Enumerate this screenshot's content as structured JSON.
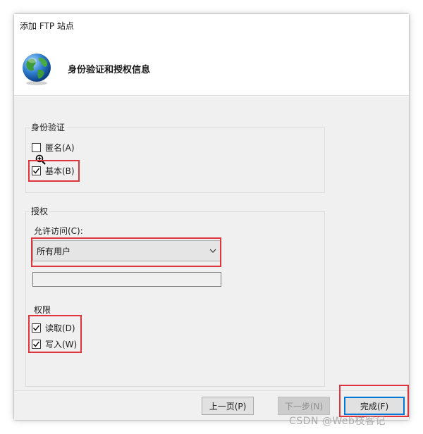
{
  "window": {
    "title": "添加 FTP 站点"
  },
  "header": {
    "title": "身份验证和授权信息",
    "icon": "globe-icon"
  },
  "authentication": {
    "label": "身份验证",
    "anonymous": {
      "label": "匿名(A)",
      "checked": false
    },
    "basic": {
      "label": "基本(B)",
      "checked": true
    }
  },
  "authorization": {
    "label": "授权",
    "allow_access_label": "允许访问(C):",
    "allow_access_value": "所有用户",
    "text_value": ""
  },
  "permissions": {
    "label": "权限",
    "read": {
      "label": "读取(D)",
      "checked": true
    },
    "write": {
      "label": "写入(W)",
      "checked": true
    }
  },
  "buttons": {
    "previous": "上一页(P)",
    "next": "下一步(N)",
    "finish": "完成(F)"
  },
  "watermark": "CSDN @Web枝客记",
  "colors": {
    "highlight": "#e0343c",
    "focus": "#0078d7"
  }
}
